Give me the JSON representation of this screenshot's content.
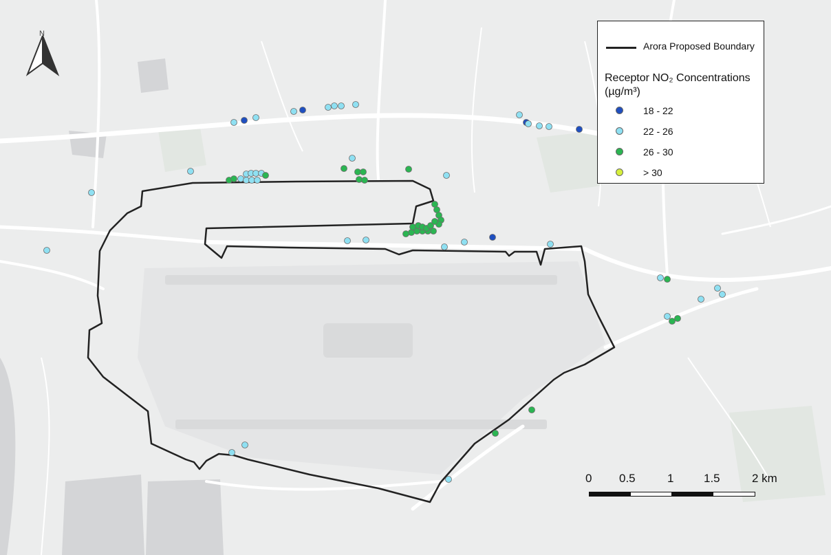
{
  "colors": {
    "background": "#eceded",
    "water": "#d5d6d8",
    "boundary": "#222222",
    "class_18_22": "#1f4fc0",
    "class_22_26": "#8fe0f2",
    "class_26_30": "#2bb552",
    "class_gt_30": "#d6ef3c"
  },
  "north_arrow": {
    "icon": "north-arrow-icon",
    "letter": "N"
  },
  "legend": {
    "boundary_label": "Arora Proposed Boundary",
    "title": "Receptor NO₂ Concentrations (µg/m³)",
    "classes": [
      {
        "label": "18 - 22",
        "color": "#1f4fc0"
      },
      {
        "label": "22 - 26",
        "color": "#8fe0f2"
      },
      {
        "label": "26 - 30",
        "color": "#2bb552"
      },
      {
        "label": "> 30",
        "color": "#d6ef3c"
      }
    ]
  },
  "scale_bar": {
    "labels": [
      "0",
      "0.5",
      "1",
      "1.5",
      "2 km"
    ]
  },
  "receptors": {
    "18_22": {
      "color": "#1f4fc0",
      "count": 5
    },
    "22_26": {
      "color": "#8fe0f2",
      "count": 37
    },
    "26_30": {
      "color": "#2bb552",
      "count": 31
    }
  }
}
